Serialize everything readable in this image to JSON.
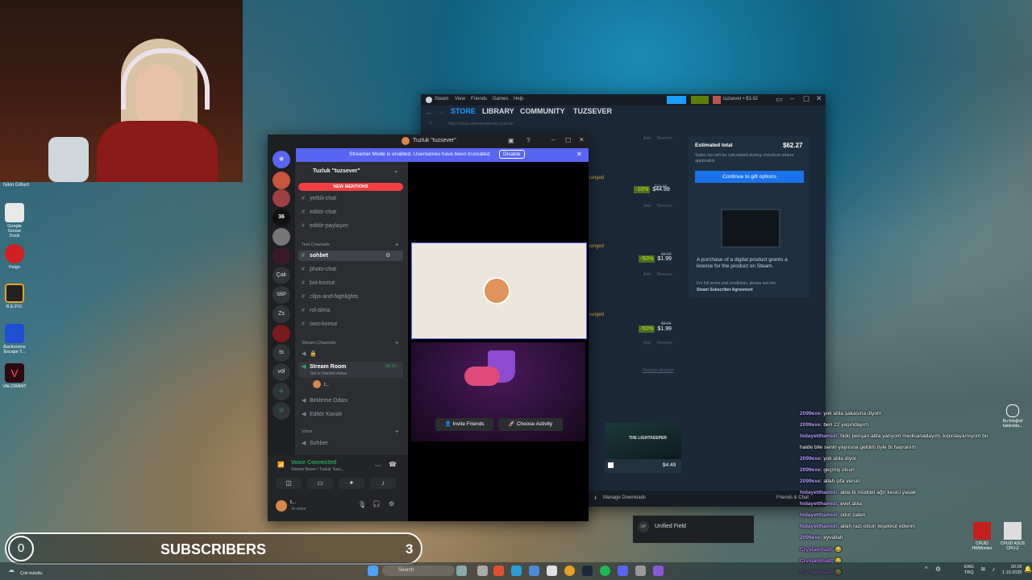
{
  "webcam": {
    "credit": "Nikki Gilbert"
  },
  "desktop_icons": [
    {
      "label": "Google Goose Duck",
      "color": "#e8e8e8"
    },
    {
      "label": "Feign",
      "color": "#d21f1f"
    },
    {
      "label": "R.E.P.O.",
      "color": "#e8a020"
    },
    {
      "label": "Backrooms Escape T...",
      "color": "#1f4fd2"
    },
    {
      "label": "VALORANT",
      "color": "#c4233a"
    }
  ],
  "discord": {
    "window_title": "Tuzluk \"tuzsever\"",
    "banner_text": "Streamer Mode is enabled. Usernames have been truncated.",
    "banner_button": "Disable",
    "server_name": "Tuzluk \"tuzsever\"",
    "new_mentions": "NEW MENTIONS",
    "channels_top": [
      "yetkili-chat",
      "editör-chat",
      "editör-paylaşım"
    ],
    "text_category": "Text Channels",
    "text_channels": [
      "sohbet",
      "photo-chat",
      "bot-komut",
      "clips-and-highlights",
      "rol-alma",
      "owo-komut"
    ],
    "stream_category": "Stream Channels",
    "stream_room": "Stream Room",
    "stream_room_status": "Set a channel status",
    "stream_room_time": "55:50",
    "stream_user": "t...",
    "voice_channels": [
      "Bekleme Odası",
      "Editör Kanalı"
    ],
    "voice_category": "Voice",
    "voice_sohbet": "Sohbet",
    "voice_connected": "Voice Connected",
    "voice_connected_sub": "Stream Room / Tuzluk \"tuzs...",
    "user_name": "t...",
    "user_status": "In voice",
    "guilds": [
      "36",
      "Çak",
      "SBP",
      "Zs",
      "ts",
      "völ"
    ],
    "invite_button": "Invite Friends",
    "activity_button": "Choose Activity"
  },
  "steam": {
    "menu": [
      "Steam",
      "View",
      "Friends",
      "Games",
      "Help"
    ],
    "nav": [
      "STORE",
      "LIBRARY",
      "COMMUNITY",
      "TUZSEVER"
    ],
    "url": "https://store.steampowered.com/cart",
    "account": "tuzsever • $3.82",
    "estimated_total_label": "Estimated total",
    "estimated_total": "$62.27",
    "tax_note": "Sales tax will be calculated during checkout where applicable",
    "gift_button": "Continue to gift options",
    "license_note": "A purchase of a digital product grants a license for the product on Steam.",
    "terms_note": "For full terms and conditions, please see the",
    "terms_link": "Steam Subscriber Agreement",
    "changed": "hanged",
    "add": "Add",
    "remove": "Remove",
    "items": [
      {
        "discount": "-10%",
        "old": "$49.99",
        "price": "$44.99"
      },
      {
        "discount": "-50%",
        "old": "$3.99",
        "price": "$1.99"
      },
      {
        "discount": "-50%",
        "old": "$3.99",
        "price": "$1.99"
      }
    ],
    "remove_all": "Remove all items",
    "rec_title": "THE LIGHTKEEPER",
    "rec_price": "$4.49",
    "manage_downloads": "Manage Downloads",
    "friends_chat": "Friends & Chat",
    "unified_field": "Unified Field",
    "unified_badge": "UF"
  },
  "chat": [
    {
      "user": "2099exe",
      "msg": ": yok abla şakasına diyom",
      "color": "#b79cff"
    },
    {
      "user": "2099exe",
      "msg": ": ben 22 yaşındayım",
      "color": "#b79cff"
    },
    {
      "user": "hidayetthamidi",
      "msg": ": hido perişan abla yatıyom medicanadayım. kıpırdayamıyom bu",
      "color": "#b79cff"
    },
    {
      "user": "",
      "msg": "halde bile senin yayınına geldim öyle bi hayranım",
      "color": "#ffffff"
    },
    {
      "user": "2099exe",
      "msg": ": yok abla diyor",
      "color": "#b79cff"
    },
    {
      "user": "2099exe",
      "msg": ": geçmiş olsun",
      "color": "#b79cff"
    },
    {
      "user": "2099exe",
      "msg": ": allah şifa versin",
      "color": "#b79cff"
    },
    {
      "user": "hidayetthamidi",
      "msg": ": abla bi müddet ağır kesici yasak",
      "color": "#b79cff"
    },
    {
      "user": "hidayetthamidi",
      "msg": ": evet abla",
      "color": "#b79cff"
    },
    {
      "user": "hidayetthamidi",
      "msg": ": odur zaten",
      "color": "#b79cff"
    },
    {
      "user": "hidayetthamidi",
      "msg": ": allah razı olsun teşekkür ederim",
      "color": "#b79cff"
    },
    {
      "user": "2099exe",
      "msg": ": eyvallah",
      "color": "#b79cff"
    },
    {
      "user": "Crystalofsalt",
      "msg": ": 😂",
      "color": "#c070ff"
    },
    {
      "user": "Crystalofsalt",
      "msg": ": 😂",
      "color": "#c070ff"
    },
    {
      "user": "Crystalofsalt",
      "msg": ": 😂",
      "color": "#c070ff"
    }
  ],
  "right_icons": [
    {
      "label": "Bu fotoğraf hakkında..."
    },
    {
      "label": "CPUID HWMonitor"
    },
    {
      "label": "CPUID ASUS CPU-Z"
    }
  ],
  "subs": {
    "current": "0",
    "label": "SUBSCRIBERS",
    "goal": "3"
  },
  "taskbar": {
    "weather": "Çok bulutlu",
    "search": "Search",
    "lang": "ENG",
    "region": "TRQ",
    "time": "20:26",
    "date": "1.10.2025"
  }
}
